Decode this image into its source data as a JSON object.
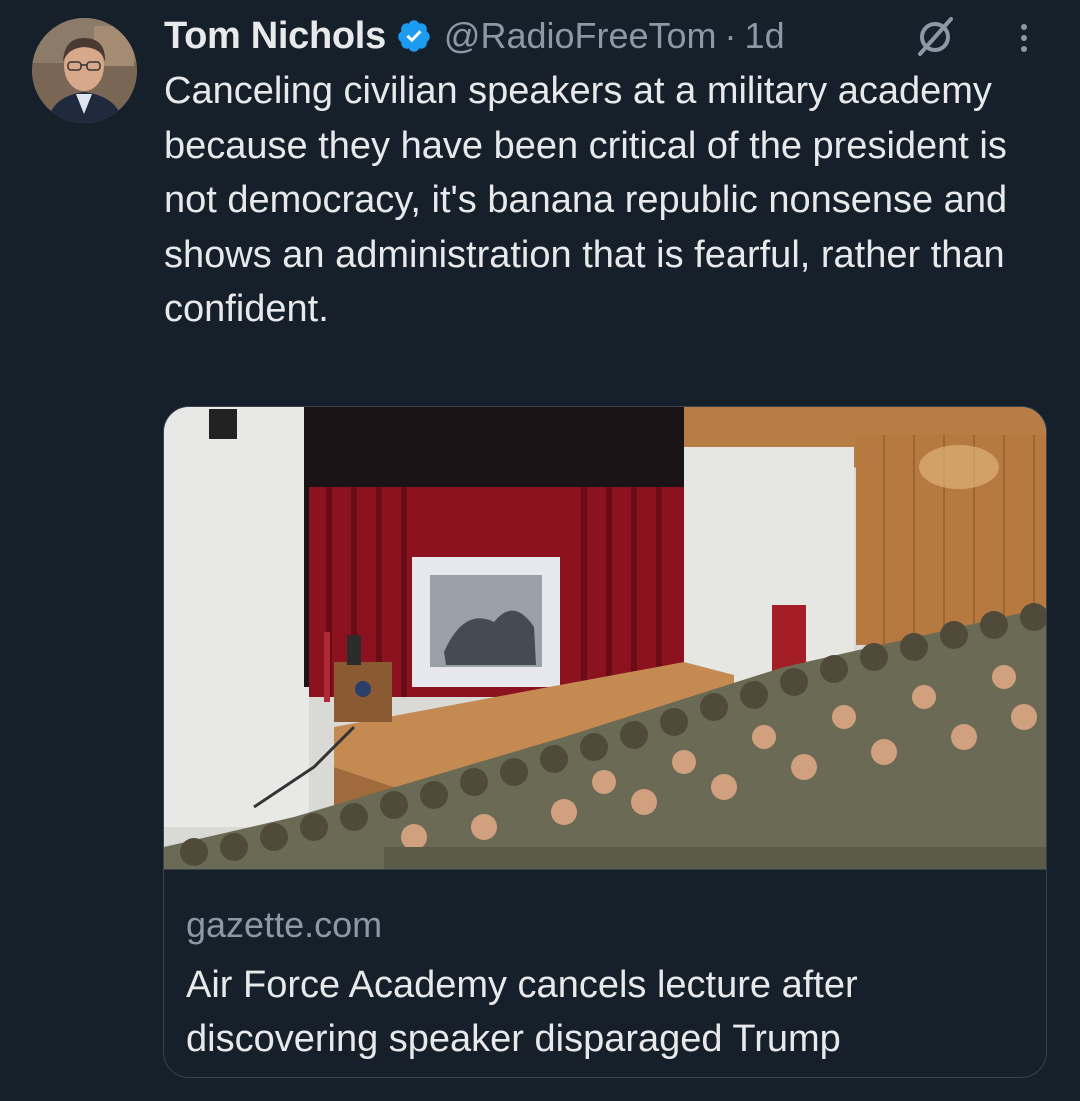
{
  "tweet": {
    "author_name": "Tom Nichols",
    "handle": "@RadioFreeTom",
    "separator": "·",
    "time": "1d",
    "text": "Canceling civilian speakers at a military academy because they have been critical of the president is not democracy, it's banana republic nonsense and shows an administration that is fearful, rather than confident.",
    "card": {
      "domain": "gazette.com",
      "headline": "Air Force Academy cancels lecture after discovering speaker disparaged Trump"
    }
  },
  "colors": {
    "background": "#15202b",
    "text": "#e7e9ea",
    "secondary": "#8b98a5",
    "verified": "#1d9bf0",
    "border": "#38444d"
  },
  "icons": [
    "avatar",
    "verified-badge-icon",
    "grok-icon",
    "more-options-icon"
  ]
}
